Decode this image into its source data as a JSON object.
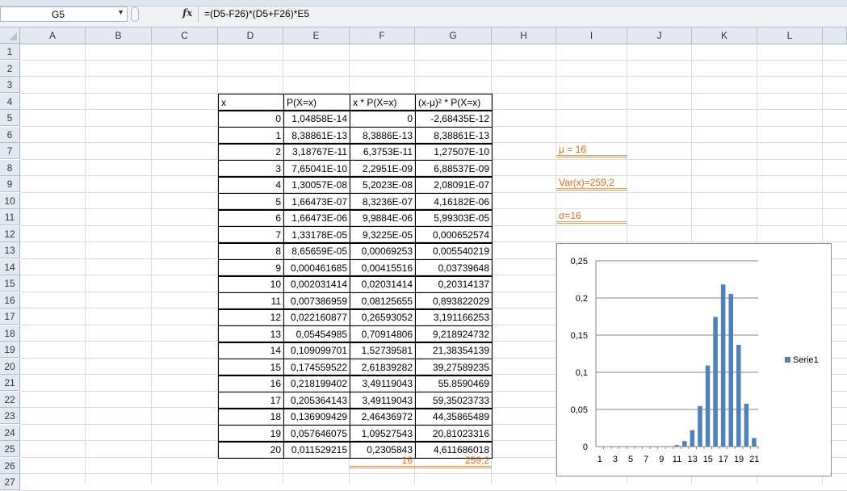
{
  "formula_bar": {
    "name_box": "G5",
    "fx_label": "fx",
    "formula": "=(D5-F26)*(D5+F26)*E5"
  },
  "columns": [
    "A",
    "B",
    "C",
    "D",
    "E",
    "F",
    "G",
    "H",
    "I",
    "J",
    "K",
    "L"
  ],
  "rows": [
    "1",
    "2",
    "3",
    "4",
    "5",
    "6",
    "7",
    "8",
    "9",
    "10",
    "11",
    "12",
    "13",
    "14",
    "15",
    "16",
    "17",
    "18",
    "19",
    "20",
    "21",
    "22",
    "23",
    "24",
    "25",
    "26",
    "27"
  ],
  "table": {
    "headers": {
      "D": "x",
      "E": "P(X=x)",
      "F": "x * P(X=x)",
      "G": "(x-μ)² * P(X=x)"
    },
    "rows": [
      [
        "0",
        "1,04858E-14",
        "0",
        "-2,68435E-12"
      ],
      [
        "1",
        "8,38861E-13",
        "8,3886E-13",
        "8,38861E-13"
      ],
      [
        "2",
        "3,18767E-11",
        "6,3753E-11",
        "1,27507E-10"
      ],
      [
        "3",
        "7,65041E-10",
        "2,2951E-09",
        "6,88537E-09"
      ],
      [
        "4",
        "1,30057E-08",
        "5,2023E-08",
        "2,08091E-07"
      ],
      [
        "5",
        "1,66473E-07",
        "8,3236E-07",
        "4,16182E-06"
      ],
      [
        "6",
        "1,66473E-06",
        "9,9884E-06",
        "5,99303E-05"
      ],
      [
        "7",
        "1,33178E-05",
        "9,3225E-05",
        "0,000652574"
      ],
      [
        "8",
        "8,65659E-05",
        "0,00069253",
        "0,005540219"
      ],
      [
        "9",
        "0,000461685",
        "0,00415516",
        "0,03739648"
      ],
      [
        "10",
        "0,002031414",
        "0,02031414",
        "0,20314137"
      ],
      [
        "11",
        "0,007386959",
        "0,08125655",
        "0,893822029"
      ],
      [
        "12",
        "0,022160877",
        "0,26593052",
        "3,191166253"
      ],
      [
        "13",
        "0,05454985",
        "0,70914806",
        "9,218924732"
      ],
      [
        "14",
        "0,109099701",
        "1,52739581",
        "21,38354139"
      ],
      [
        "15",
        "0,174559522",
        "2,61839282",
        "39,27589235"
      ],
      [
        "16",
        "0,218199402",
        "3,49119043",
        "55,8590469"
      ],
      [
        "17",
        "0,205364143",
        "3,49119043",
        "59,35023733"
      ],
      [
        "18",
        "0,136909429",
        "2,46436972",
        "44,35865489"
      ],
      [
        "19",
        "0,057646075",
        "1,09527543",
        "20,81023316"
      ],
      [
        "20",
        "0,011529215",
        "0,2305843",
        "4,611686018"
      ]
    ],
    "totals": {
      "F": "16",
      "G": "259,2"
    }
  },
  "stats": {
    "mu": "μ = 16",
    "var": "Var(x)=259,2",
    "sigma": "σ=16"
  },
  "colors": {
    "orange_text": "#e26b0a",
    "orange_border": "#f79646",
    "bar": "#4f81bd",
    "header_bg": "#e4e9f0"
  },
  "chart_data": {
    "type": "bar",
    "categories": [
      "1",
      "3",
      "5",
      "7",
      "9",
      "11",
      "13",
      "15",
      "17",
      "19",
      "21"
    ],
    "x": [
      1,
      2,
      3,
      4,
      5,
      6,
      7,
      8,
      9,
      10,
      11,
      12,
      13,
      14,
      15,
      16,
      17,
      18,
      19,
      20,
      21
    ],
    "series": [
      {
        "name": "Serie1",
        "values": [
          1.04858e-14,
          8.38861e-13,
          3.18767e-11,
          7.65041e-10,
          1.30057e-08,
          1.66473e-07,
          1.66473e-06,
          1.33178e-05,
          8.65659e-05,
          0.000461685,
          0.002031414,
          0.007386959,
          0.022160877,
          0.05454985,
          0.109099701,
          0.174559522,
          0.218199402,
          0.205364143,
          0.136909429,
          0.057646075,
          0.011529215
        ]
      }
    ],
    "yticks": [
      "0",
      "0,05",
      "0,1",
      "0,15",
      "0,2",
      "0,25"
    ],
    "ylim": [
      0,
      0.25
    ],
    "grid": true,
    "legend": "right"
  }
}
